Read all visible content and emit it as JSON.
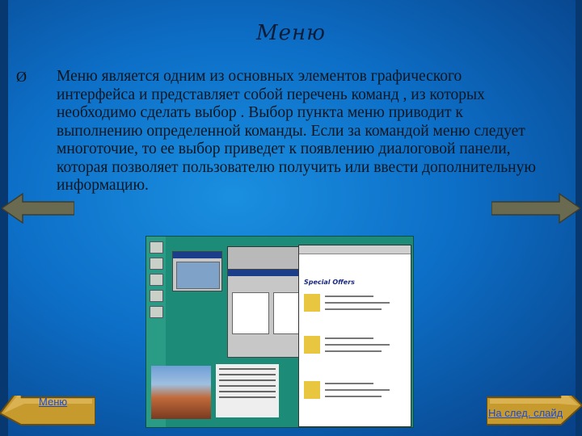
{
  "slide": {
    "title": "Меню",
    "bullet_symbol": "Ø",
    "body_text": "Меню является одним из основных элементов графического интерфейса и представляет собой перечень команд , из которых необходимо сделать выбор . Выбор пункта меню приводит к выполнению определенной команды. Если за командой меню следует многоточие, то ее выбор приведет к появлению диалоговой панели, которая позволяет пользователю получить или ввести дополнительную информацию."
  },
  "navigation": {
    "menu_button_label": "Меню",
    "next_button_label": "На след. слайд"
  },
  "screenshot": {
    "offers_title": "Special Offers"
  },
  "colors": {
    "background": "#0d6fc7",
    "arrow": "#6a6a50",
    "button_face": "#c79a2e",
    "link": "#1a4bd6"
  }
}
